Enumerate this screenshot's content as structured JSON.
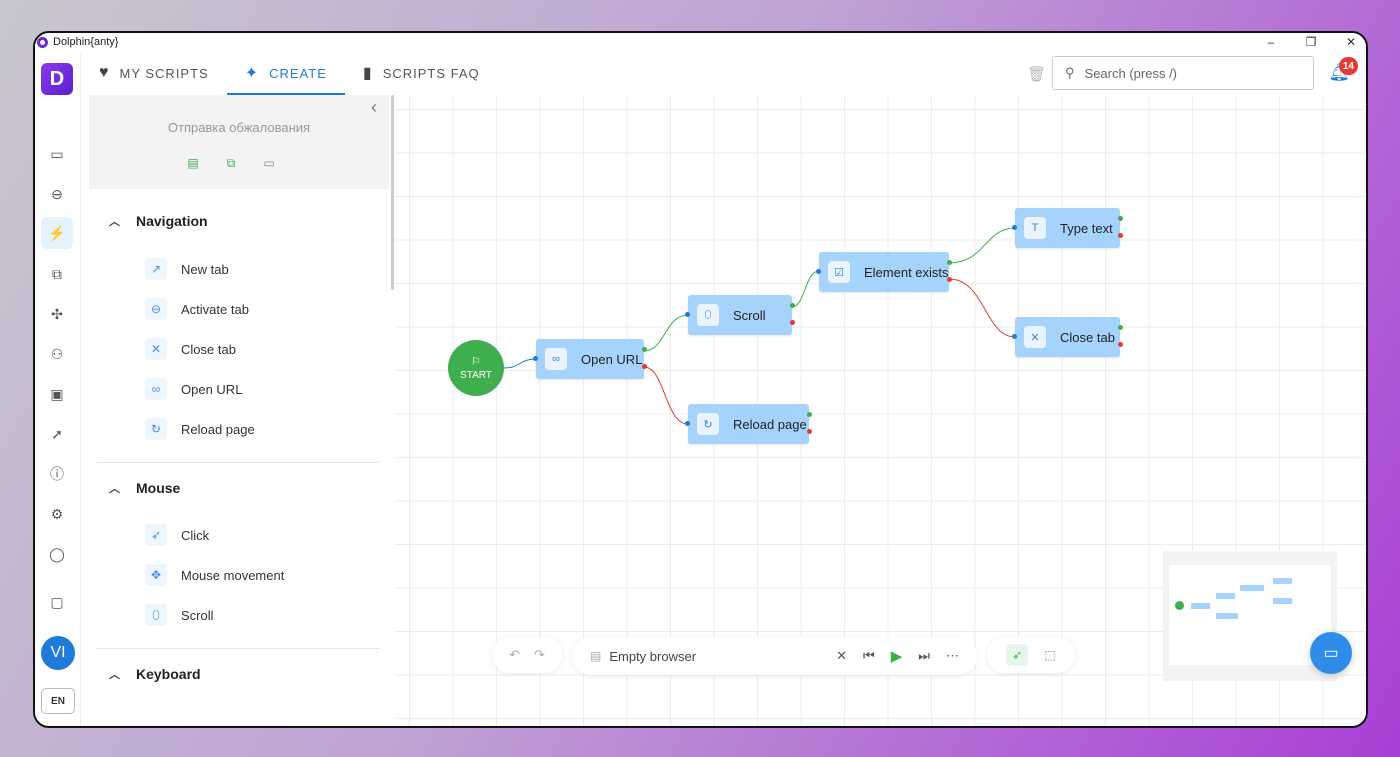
{
  "app": {
    "title": "Dolphin{anty}"
  },
  "window_controls": {
    "minimize": "–",
    "restore": "❐",
    "close": "✕"
  },
  "leftbar": {
    "logo": "D",
    "icons": [
      "browser-profiles-icon",
      "link-icon",
      "scripts-icon",
      "copy-icon",
      "extensions-icon",
      "users-icon",
      "api-icon",
      "rocket-icon",
      "help-icon",
      "settings-icon",
      "idea-icon",
      "wallet-icon"
    ],
    "avatar_initials": "VI",
    "language": "EN"
  },
  "topnav": {
    "tabs": [
      {
        "label": "MY SCRIPTS",
        "icon": "heart-icon"
      },
      {
        "label": "CREATE",
        "icon": "sparkle-icon",
        "active": true
      },
      {
        "label": "SCRIPTS FAQ",
        "icon": "book-icon"
      }
    ],
    "search_placeholder": "Search (press /)",
    "notification_count": "14"
  },
  "panel": {
    "script_name": "Отправка обжалования",
    "sections": [
      {
        "title": "Navigation",
        "items": [
          {
            "label": "New tab",
            "icon": "external-link-icon"
          },
          {
            "label": "Activate tab",
            "icon": "link-icon"
          },
          {
            "label": "Close tab",
            "icon": "close-icon"
          },
          {
            "label": "Open URL",
            "icon": "chain-icon"
          },
          {
            "label": "Reload page",
            "icon": "reload-icon"
          }
        ]
      },
      {
        "title": "Mouse",
        "items": [
          {
            "label": "Click",
            "icon": "cursor-click-icon"
          },
          {
            "label": "Mouse movement",
            "icon": "move-icon"
          },
          {
            "label": "Scroll",
            "icon": "mouse-icon"
          }
        ]
      },
      {
        "title": "Keyboard",
        "items": []
      }
    ]
  },
  "flow": {
    "start_label": "START",
    "nodes": [
      {
        "id": "open-url",
        "label": "Open URL",
        "icon": "chain-icon"
      },
      {
        "id": "scroll",
        "label": "Scroll",
        "icon": "mouse-icon"
      },
      {
        "id": "reload-page",
        "label": "Reload page",
        "icon": "reload-icon"
      },
      {
        "id": "element-exists",
        "label": "Element exists",
        "icon": "checkbox-icon"
      },
      {
        "id": "type-text",
        "label": "Type text",
        "icon": "text-icon"
      },
      {
        "id": "close-tab",
        "label": "Close tab",
        "icon": "close-icon"
      }
    ]
  },
  "player": {
    "browser_label": "Empty browser"
  },
  "colors": {
    "accent": "#1f7ad8",
    "node": "#a6d3fb",
    "success": "#3eae4f",
    "error": "#e53935",
    "logo": "#7a2fe0"
  }
}
